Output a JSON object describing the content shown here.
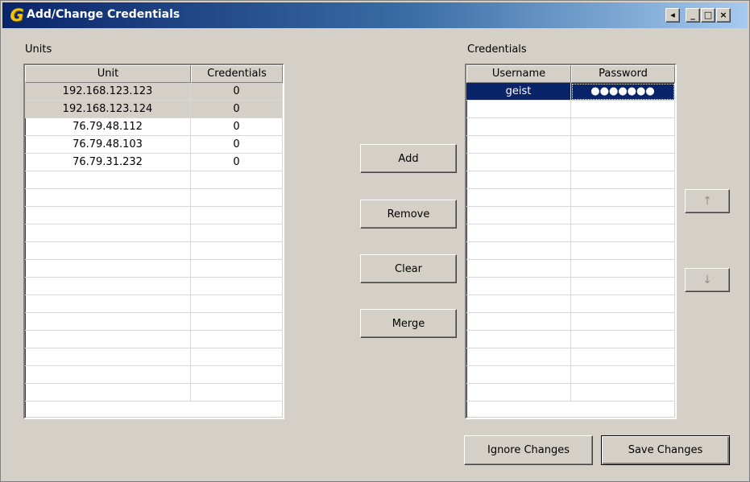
{
  "window": {
    "title": "Add/Change Credentials",
    "app_icon_letter": "G",
    "title_buttons": [
      "◂",
      "_",
      "□",
      "×"
    ]
  },
  "units": {
    "label": "Units",
    "columns": [
      "Unit",
      "Credentials"
    ],
    "rows": [
      {
        "unit": "192.168.123.123",
        "credentials": "0",
        "highlighted": true
      },
      {
        "unit": "192.168.123.124",
        "credentials": "0",
        "highlighted": true
      },
      {
        "unit": "76.79.48.112",
        "credentials": "0",
        "highlighted": false
      },
      {
        "unit": "76.79.48.103",
        "credentials": "0",
        "highlighted": false
      },
      {
        "unit": "76.79.31.232",
        "credentials": "0",
        "highlighted": false
      }
    ]
  },
  "actions": {
    "add": "Add",
    "remove": "Remove",
    "clear": "Clear",
    "merge": "Merge"
  },
  "credentials": {
    "label": "Credentials",
    "columns": [
      "Username",
      "Password"
    ],
    "rows": [
      {
        "username": "geist",
        "password": "●●●●●●●",
        "selected": true
      }
    ]
  },
  "move": {
    "up": "↑",
    "down": "↓"
  },
  "footer": {
    "ignore": "Ignore Changes",
    "save": "Save Changes"
  },
  "colors": {
    "selection": "#0a246a",
    "dialog_face": "#d4d0c8",
    "highlight_row": "#d4d0c8"
  }
}
